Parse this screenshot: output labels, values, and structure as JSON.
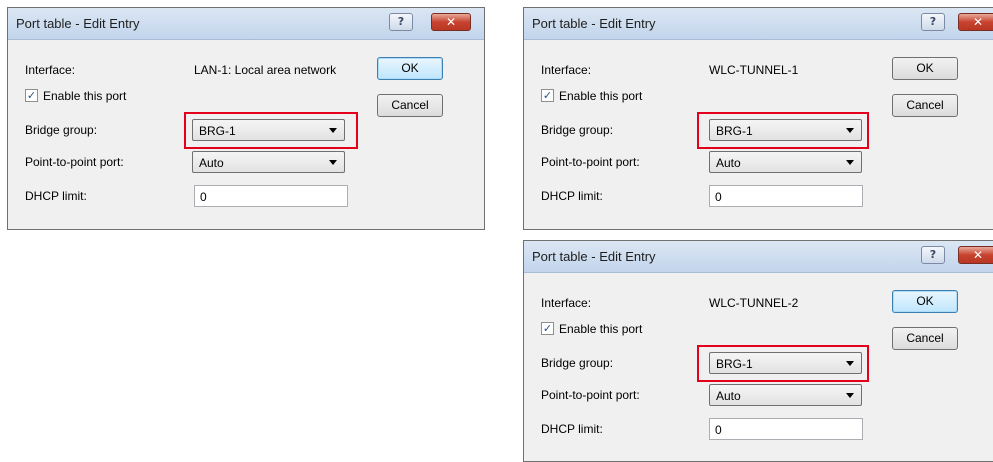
{
  "dialogs": [
    {
      "title": "Port table - Edit Entry",
      "help_label": "?",
      "close_label": "✕",
      "interface_label": "Interface:",
      "interface_value": "LAN-1: Local area network",
      "enable_label": "Enable this port",
      "enable_checked": true,
      "bridge_label": "Bridge group:",
      "bridge_value": "BRG-1",
      "p2p_label": "Point-to-point port:",
      "p2p_value": "Auto",
      "dhcp_label": "DHCP limit:",
      "dhcp_value": "0",
      "ok_label": "OK",
      "cancel_label": "Cancel"
    },
    {
      "title": "Port table - Edit Entry",
      "help_label": "?",
      "close_label": "✕",
      "interface_label": "Interface:",
      "interface_value": "WLC-TUNNEL-1",
      "enable_label": "Enable this port",
      "enable_checked": true,
      "bridge_label": "Bridge group:",
      "bridge_value": "BRG-1",
      "p2p_label": "Point-to-point port:",
      "p2p_value": "Auto",
      "dhcp_label": "DHCP limit:",
      "dhcp_value": "0",
      "ok_label": "OK",
      "cancel_label": "Cancel"
    },
    {
      "title": "Port table - Edit Entry",
      "help_label": "?",
      "close_label": "✕",
      "interface_label": "Interface:",
      "interface_value": "WLC-TUNNEL-2",
      "enable_label": "Enable this port",
      "enable_checked": true,
      "bridge_label": "Bridge group:",
      "bridge_value": "BRG-1",
      "p2p_label": "Point-to-point port:",
      "p2p_value": "Auto",
      "dhcp_label": "DHCP limit:",
      "dhcp_value": "0",
      "ok_label": "OK",
      "cancel_label": "Cancel"
    }
  ],
  "colors": {
    "highlight": "#e3001b",
    "dialog_bg": "#f0f0f0",
    "titlebar": "#c2d5ec"
  }
}
